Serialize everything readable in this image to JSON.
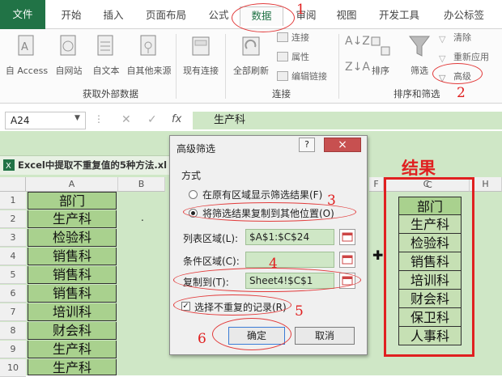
{
  "ribbon": {
    "tabs": [
      "文件",
      "开始",
      "插入",
      "页面布局",
      "公式",
      "数据",
      "审阅",
      "视图",
      "开发工具",
      "办公标签"
    ],
    "active_tab": "数据",
    "groups": {
      "external_data": {
        "label": "获取外部数据",
        "buttons": [
          "自 Access",
          "自网站",
          "自文本",
          "自其他来源",
          "现有连接"
        ]
      },
      "connections": {
        "label": "连接",
        "refresh_all": "全部刷新",
        "items": [
          "连接",
          "属性",
          "编辑链接"
        ]
      },
      "sort_filter": {
        "label": "排序和筛选",
        "sort": "排序",
        "filter": "筛选",
        "items": [
          "清除",
          "重新应用",
          "高级"
        ]
      }
    }
  },
  "formula_bar": {
    "name_box": "A24",
    "fx": "fx",
    "value": "生产科"
  },
  "workbook": {
    "title": "Excel中提取不重复值的5种方法.xl"
  },
  "sheet": {
    "columns": [
      "A",
      "B",
      "C",
      "H",
      "F"
    ],
    "rows": [
      "1",
      "2",
      "3",
      "4",
      "5",
      "6",
      "7",
      "8",
      "9",
      "10"
    ],
    "column_a": [
      "部门",
      "生产科",
      "检验科",
      "销售科",
      "销售科",
      "销售科",
      "培训科",
      "财会科",
      "生产科",
      "生产科"
    ],
    "b2_dot": ".",
    "column_c": [
      "部门",
      "生产科",
      "检验科",
      "销售科",
      "培训科",
      "财会科",
      "保卫科",
      "人事科"
    ],
    "result_label": "结果"
  },
  "dialog": {
    "title": "高级筛选",
    "help": "?",
    "close": "×",
    "section": "方式",
    "option1": "在原有区域显示筛选结果(F)",
    "option2": "将筛选结果复制到其他位置(O)",
    "list_range_label": "列表区域(L):",
    "list_range_value": "$A$1:$C$24",
    "criteria_label": "条件区域(C):",
    "criteria_value": "",
    "copy_to_label": "复制到(T):",
    "copy_to_value": "Sheet4!$C$1",
    "unique_label": "选择不重复的记录(R)",
    "ok": "确定",
    "cancel": "取消"
  },
  "annotations": {
    "n1": "1",
    "n2": "2",
    "n3": "3",
    "n4": "4",
    "n5": "5",
    "n6": "6"
  },
  "colors": {
    "file_tab": "#217346",
    "cell_green": "#a9d18e",
    "result_green": "#c6e0b4",
    "annotation_red": "#e02020"
  }
}
